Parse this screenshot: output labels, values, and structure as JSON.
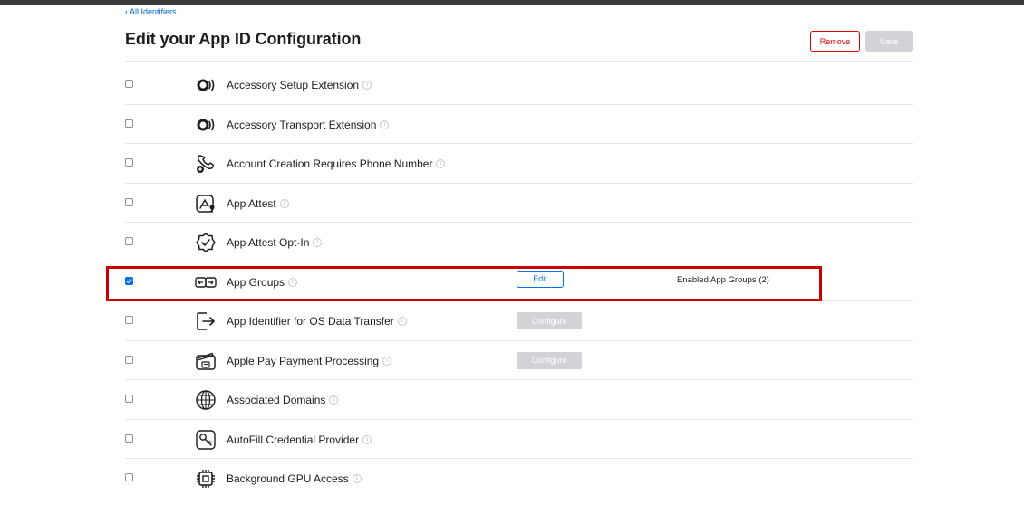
{
  "breadcrumb": {
    "back_label": "‹ All Identifiers"
  },
  "header": {
    "title": "Edit your App ID Configuration",
    "remove_label": "Remove",
    "save_label": "Save"
  },
  "capabilities": [
    {
      "name": "Accessory Setup Extension",
      "icon": "accessory-icon",
      "checked": false
    },
    {
      "name": "Accessory Transport Extension",
      "icon": "accessory-icon",
      "checked": false
    },
    {
      "name": "Account Creation Requires Phone Number",
      "icon": "phone-number-icon",
      "checked": false
    },
    {
      "name": "App Attest",
      "icon": "app-attest-icon",
      "checked": false
    },
    {
      "name": "App Attest Opt-In",
      "icon": "seal-check-icon",
      "checked": false
    },
    {
      "name": "App Groups",
      "icon": "app-groups-icon",
      "checked": true,
      "action_label": "Edit",
      "status": "Enabled App Groups (2)"
    },
    {
      "name": "App Identifier for OS Data Transfer",
      "icon": "data-transfer-icon",
      "checked": false,
      "action_label": "Configure"
    },
    {
      "name": "Apple Pay Payment Processing",
      "icon": "wallet-icon",
      "checked": false,
      "action_label": "Configure"
    },
    {
      "name": "Associated Domains",
      "icon": "globe-icon",
      "checked": false
    },
    {
      "name": "AutoFill Credential Provider",
      "icon": "key-icon",
      "checked": false
    },
    {
      "name": "Background GPU Access",
      "icon": "chip-icon",
      "checked": false
    }
  ],
  "colors": {
    "accent": "#0071e3",
    "danger": "#e30000",
    "highlight": "#cc0000",
    "disabled": "#d2d2d7"
  }
}
